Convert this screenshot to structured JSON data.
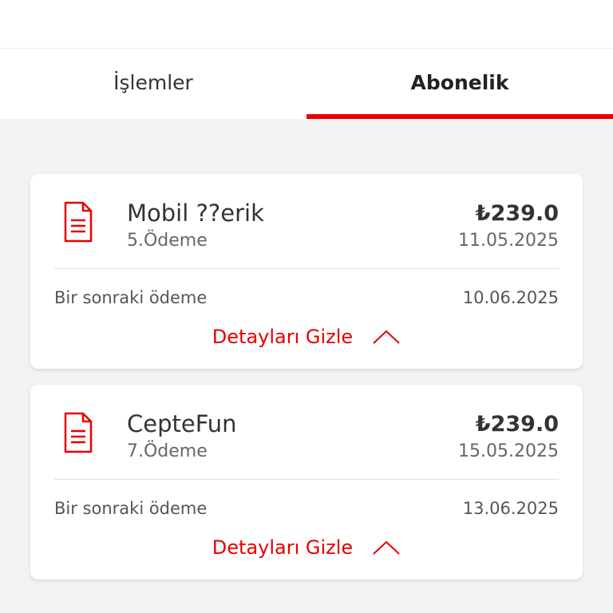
{
  "tabs": [
    {
      "label": "İşlemler",
      "active": false
    },
    {
      "label": "Abonelik",
      "active": true
    }
  ],
  "subscriptions": [
    {
      "title": "Mobil ??erik",
      "payment_no": "5.Ödeme",
      "amount": "₺239.0",
      "date": "11.05.2025",
      "next_label": "Bir sonraki ödeme",
      "next_date": "10.06.2025",
      "toggle_label": "Detayları Gizle"
    },
    {
      "title": "CepteFun",
      "payment_no": "7.Ödeme",
      "amount": "₺239.0",
      "date": "15.05.2025",
      "next_label": "Bir sonraki ödeme",
      "next_date": "13.06.2025",
      "toggle_label": "Detayları Gizle"
    }
  ],
  "colors": {
    "accent": "#e60000",
    "background": "#f2f2f2",
    "card": "#ffffff"
  },
  "icons": {
    "document": "document-icon",
    "chevron": "chevron-up-icon"
  }
}
